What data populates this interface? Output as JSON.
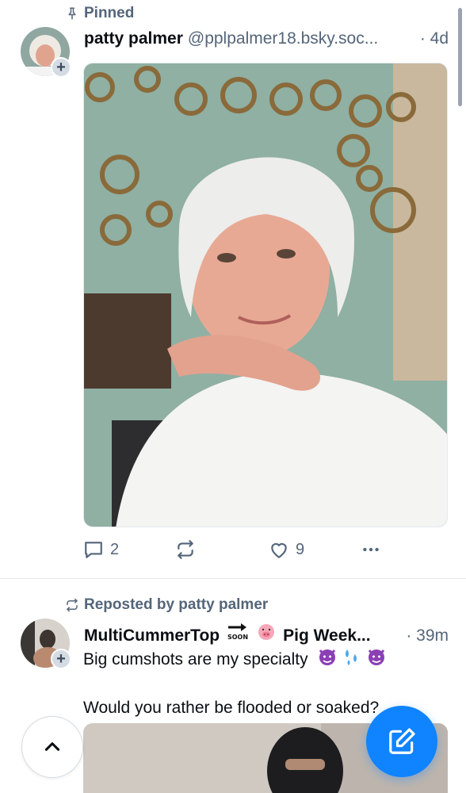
{
  "posts": [
    {
      "context": {
        "icon": "pin-icon",
        "label": "Pinned"
      },
      "author": {
        "name": "patty palmer",
        "handle": "@pplpalmer18.bsky.soc...",
        "time": "· 4d"
      },
      "actions": {
        "replies": "2",
        "likes": "9"
      }
    },
    {
      "context": {
        "icon": "repost-icon",
        "label": "Reposted by patty palmer"
      },
      "author": {
        "name": "MultiCummerTop",
        "name_suffix": "Pig Week...",
        "time": "· 39m"
      },
      "text_line1": "Big cumshots are my specialty",
      "text_line2": "Would you rather be flooded or soaked?"
    }
  ],
  "ui": {
    "scroll_top_icon": "chevron-up-icon",
    "compose_icon": "compose-icon",
    "accent": "#1083fe",
    "muted": "#54657a"
  }
}
